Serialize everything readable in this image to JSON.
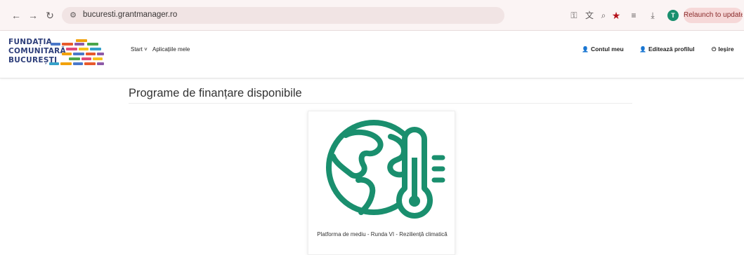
{
  "browser": {
    "back_glyph": "←",
    "forward_glyph": "→",
    "reload_glyph": "↻",
    "url": "bucuresti.grantmanager.ro",
    "profile_initial": "T",
    "relaunch_label": "Relaunch to update"
  },
  "site": {
    "logo": {
      "line1": "FUNDAȚIA",
      "line2": "COMUNITARĂ",
      "line3": "BUCUREȘTI",
      "brick_colors": [
        "#f2a20c",
        "#4a78c9",
        "#e85a2c",
        "#8e5aa8",
        "#4aa64a",
        "#e04a7a",
        "#f7c21b",
        "#35a1c9"
      ]
    },
    "nav": {
      "start_label": "Start ˅",
      "apps_label": "Aplicațiile mele",
      "account_label": "Contul meu",
      "edit_profile_label": "Editează profilul",
      "logout_label": "Ieșire"
    }
  },
  "main": {
    "title": "Programe de finanțare disponibile",
    "cards": [
      {
        "title": "Platforma de mediu - Runda VI - Reziliență climatică",
        "icon": "globe-thermometer-icon"
      }
    ]
  },
  "colors": {
    "accent": "#1a8f6e",
    "logo_blue": "#2d3e7a"
  }
}
